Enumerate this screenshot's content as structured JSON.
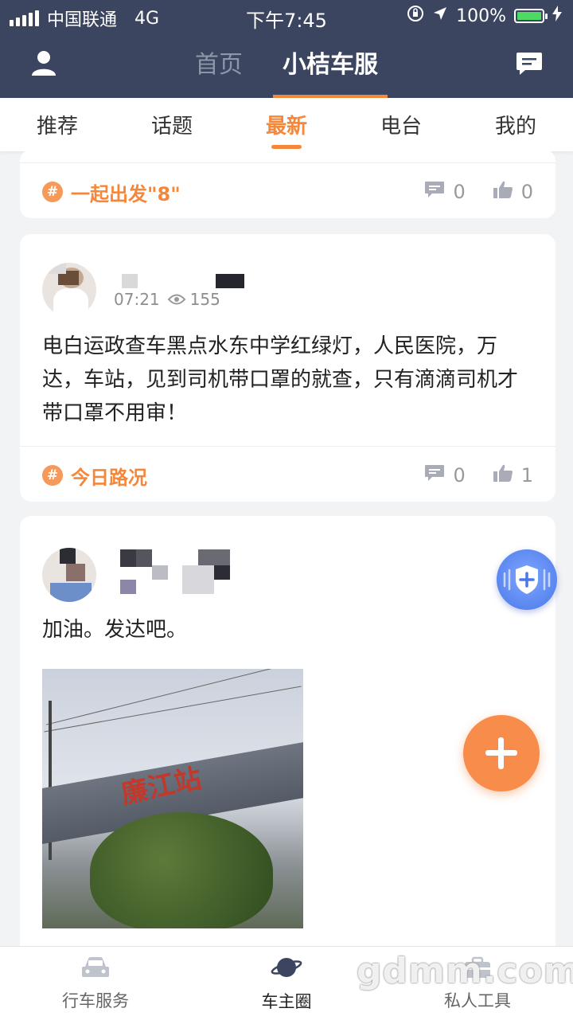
{
  "status_bar": {
    "carrier": "中国联通",
    "network": "4G",
    "time": "下午7:45",
    "battery": "100%"
  },
  "nav": {
    "tabs": [
      {
        "label": "首页"
      },
      {
        "label": "小桔车服"
      }
    ],
    "active_tab": "小桔车服"
  },
  "sub_tabs": [
    {
      "label": "推荐"
    },
    {
      "label": "话题"
    },
    {
      "label": "最新"
    },
    {
      "label": "电台"
    },
    {
      "label": "我的"
    }
  ],
  "active_sub_tab": "最新",
  "posts": [
    {
      "tag": "一起出发\"8\"",
      "comments": "0",
      "likes": "0"
    },
    {
      "time": "07:21",
      "views": "155",
      "text": "电白运政查车黑点水东中学红绿灯，人民医院，万达，车站，见到司机带口罩的就查，只有滴滴司机才带口罩不用审！",
      "tag": "今日路况",
      "comments": "0",
      "likes": "1"
    },
    {
      "text": "加油。发达吧。",
      "image_sign": "廉江站"
    }
  ],
  "bottom_tabs": [
    {
      "label": "行车服务"
    },
    {
      "label": "车主圈"
    },
    {
      "label": "私人工具"
    }
  ],
  "active_bottom_tab": "车主圈",
  "watermark": "gdmm.com",
  "colors": {
    "header_bg": "#3c4560",
    "accent": "#f5873a",
    "fab": "#f88d4b",
    "shield": "#4a78e8"
  }
}
